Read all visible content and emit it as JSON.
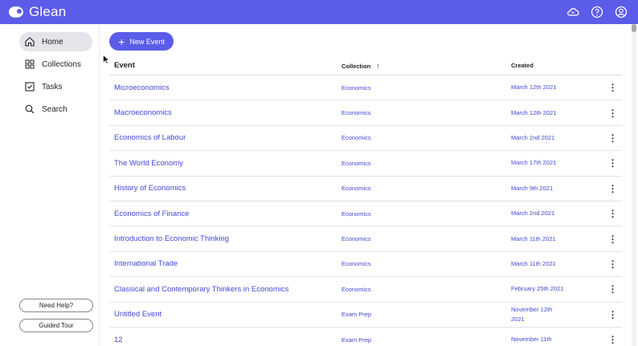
{
  "app": {
    "name": "Glean"
  },
  "colors": {
    "brand": "#5b5ce8",
    "link": "#4447d6"
  },
  "topbar_icons": [
    "cloud-sync-icon",
    "help-icon",
    "account-icon"
  ],
  "sidebar": {
    "items": [
      {
        "label": "Home",
        "icon": "home-icon",
        "active": true
      },
      {
        "label": "Collections",
        "icon": "grid-icon",
        "active": false
      },
      {
        "label": "Tasks",
        "icon": "checkbox-icon",
        "active": false
      },
      {
        "label": "Search",
        "icon": "search-icon",
        "active": false
      }
    ],
    "need_help": "Need Help?",
    "guided_tour": "Guided Tour"
  },
  "main": {
    "new_event_label": "New Event",
    "columns": {
      "event": "Event",
      "collection": "Collection",
      "created": "Created"
    },
    "rows": [
      {
        "event": "Microeconomics",
        "collection": "Economics",
        "created": "March 12th 2021"
      },
      {
        "event": "Macroeconomics",
        "collection": "Economics",
        "created": "March 12th 2021"
      },
      {
        "event": "Economics of Labour",
        "collection": "Economics",
        "created": "March 2nd 2021"
      },
      {
        "event": "The World Economy",
        "collection": "Economics",
        "created": "March 17th 2021"
      },
      {
        "event": "History of Economics",
        "collection": "Economics",
        "created": "March 9th 2021"
      },
      {
        "event": "Economics of Finance",
        "collection": "Economics",
        "created": "March 2nd 2021"
      },
      {
        "event": "Introduction to Economic Thinking",
        "collection": "Economics",
        "created": "March 11th 2021"
      },
      {
        "event": "International Trade",
        "collection": "Economics",
        "created": "March 11th 2021"
      },
      {
        "event": "Classical and Contemporary Thinkers in Economics",
        "collection": "Economics",
        "created": "February 25th 2021"
      },
      {
        "event": "Untitled Event",
        "collection": "Exam Prep",
        "created": "November 12th 2021"
      },
      {
        "event": "12",
        "collection": "Exam Prep",
        "created": "November 11th"
      }
    ]
  }
}
